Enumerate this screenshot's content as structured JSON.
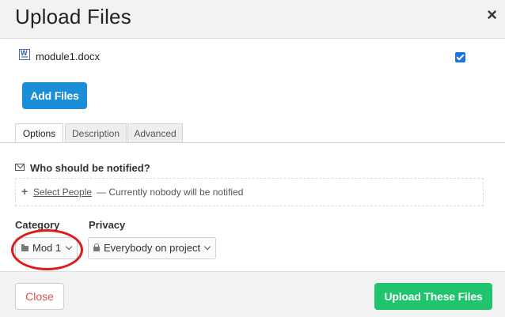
{
  "dialog": {
    "title": "Upload Files",
    "close_glyph": "×"
  },
  "files": [
    {
      "name": "module1.docx",
      "icon": "word-doc-icon",
      "checked": true
    }
  ],
  "add_files_label": "Add Files",
  "tabs": [
    {
      "label": "Options",
      "active": true
    },
    {
      "label": "Description",
      "active": false
    },
    {
      "label": "Advanced",
      "active": false
    }
  ],
  "notify": {
    "heading": "Who should be notified?",
    "icon": "envelope-icon",
    "plus": "+",
    "select_people": "Select People",
    "status": "— Currently nobody will be notified"
  },
  "category": {
    "label": "Category",
    "value": "Mod 1",
    "icon": "folder-icon"
  },
  "privacy": {
    "label": "Privacy",
    "value": "Everybody on project",
    "icon": "lock-icon"
  },
  "footer": {
    "close_label": "Close",
    "upload_label": "Upload These Files"
  },
  "colors": {
    "primary_blue": "#1a8fd8",
    "upload_green": "#1fc46c",
    "close_red": "#d9534f",
    "annotation_red": "#e01b1b",
    "checkbox_blue": "#1a73e8"
  }
}
